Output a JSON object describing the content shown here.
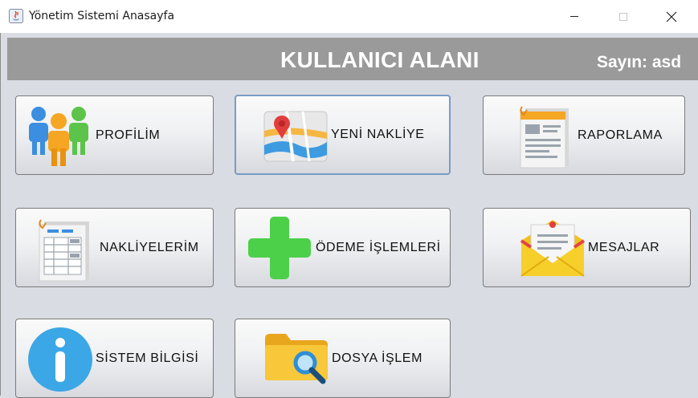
{
  "window": {
    "title": "Yönetim Sistemi Anasayfa"
  },
  "header": {
    "title": "KULLANICI ALANI",
    "user_greeting": "Sayın: asd"
  },
  "buttons": [
    {
      "label": "PROFİLİM",
      "icon": "users-icon"
    },
    {
      "label": "YENİ NAKLİYE",
      "icon": "map-icon"
    },
    {
      "label": "RAPORLAMA",
      "icon": "report-document-icon"
    },
    {
      "label": "NAKLİYELERİM",
      "icon": "spreadsheet-document-icon"
    },
    {
      "label": "ÖDEME İŞLEMLERİ",
      "icon": "plus-icon"
    },
    {
      "label": "MESAJLAR",
      "icon": "mail-icon"
    },
    {
      "label": "SİSTEM BİLGİSİ",
      "icon": "info-icon"
    },
    {
      "label": "DOSYA İŞLEM",
      "icon": "folder-search-icon"
    }
  ],
  "colors": {
    "header_bar": "#9a9a9a",
    "background": "#d9dce3",
    "focus_border": "#7b9bc4"
  }
}
